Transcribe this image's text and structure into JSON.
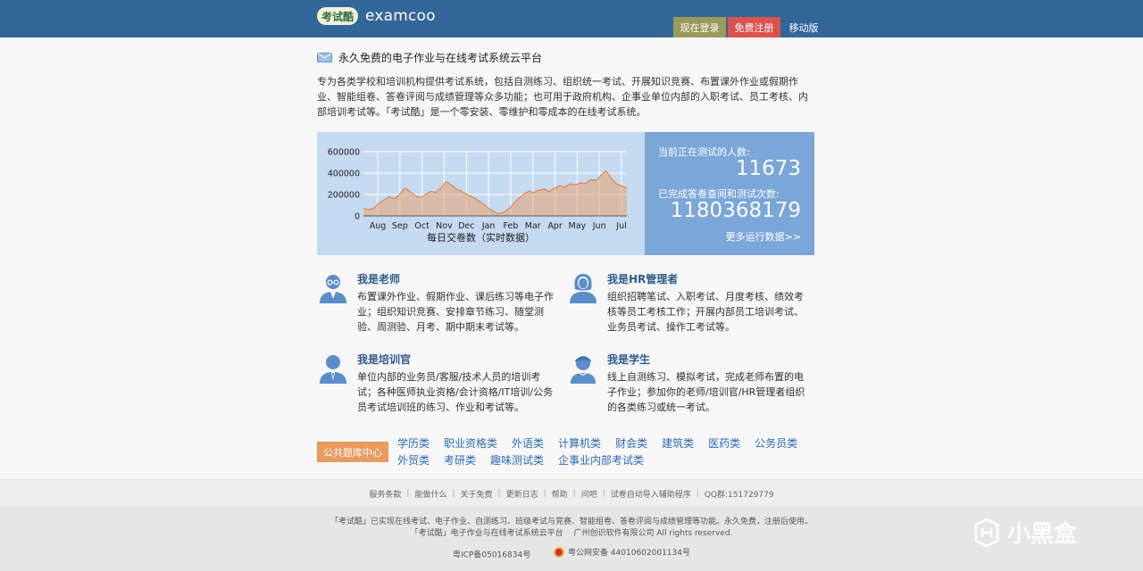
{
  "header": {
    "logo_badge": "考试酷",
    "logo_text": "examcoo",
    "login_label": "现在登录",
    "register_label": "免费注册",
    "mobile_label": "移动版"
  },
  "intro": {
    "title": "永久免费的电子作业与在线考试系统云平台",
    "desc": "专为各类学校和培训机构提供考试系统，包括自测练习、组织统一考试、开展知识竞赛、布置课外作业或假期作业、智能组卷、答卷评阅与成绩管理等众多功能；也可用于政府机构、企事业单位内部的入职考试、员工考核、内部培训考试等。「考试酷」是一个零安装、零维护和零成本的在线考试系统。"
  },
  "chart_data": {
    "type": "area",
    "title": "每日交卷数（实时数据）",
    "categories": [
      "Aug",
      "Sep",
      "Oct",
      "Nov",
      "Dec",
      "Jan",
      "Feb",
      "Mar",
      "Apr",
      "May",
      "Jun",
      "Jul"
    ],
    "y_ticks": [
      "600000",
      "400000",
      "200000",
      "0"
    ],
    "ylim": [
      0,
      600000
    ],
    "grid": true,
    "color": "#e8a070",
    "values": [
      70000,
      60000,
      70000,
      120000,
      150000,
      180000,
      160000,
      200000,
      260000,
      230000,
      190000,
      170000,
      200000,
      230000,
      220000,
      260000,
      320000,
      290000,
      250000,
      230000,
      200000,
      180000,
      150000,
      120000,
      80000,
      50000,
      20000,
      30000,
      60000,
      110000,
      160000,
      200000,
      230000,
      220000,
      240000,
      250000,
      230000,
      260000,
      280000,
      270000,
      300000,
      290000,
      310000,
      300000,
      340000,
      330000,
      380000,
      420000,
      350000,
      300000,
      280000,
      260000
    ]
  },
  "stats": {
    "testing_label": "当前正在测试的人数:",
    "testing_value": "11673",
    "completed_label": "已完成答卷查阅和测试次数:",
    "completed_value": "1180368179",
    "more_label": "更多运行数据>>"
  },
  "roles": [
    {
      "title": "我是老师",
      "desc": "布置课外作业、假期作业、课后练习等电子作业；组织知识竞赛、安排章节练习、随堂测验、周测验、月考、期中期末考试等。"
    },
    {
      "title": "我是HR管理者",
      "desc": "组织招聘笔试、入职考试、月度考核、绩效考核等员工考核工作；开展内部员工培训考试、业务员考试、操作工考试等。"
    },
    {
      "title": "我是培训官",
      "desc": "单位内部的业务员/客服/技术人员的培训考试；各种医师执业资格/会计资格/IT培训/公务员考试培训班的练习、作业和考试等。"
    },
    {
      "title": "我是学生",
      "desc": "线上自测练习、模拟考试，完成老师布置的电子作业；参加你的老师/培训官/HR管理者组织的各类练习或统一考试。"
    }
  ],
  "library": {
    "tag": "公共题库中心",
    "links": [
      "学历类",
      "职业资格类",
      "外语类",
      "计算机类",
      "财会类",
      "建筑类",
      "医药类",
      "公务员类",
      "外贸类",
      "考研类",
      "趣味测试类",
      "企事业内部考试类"
    ]
  },
  "footer": {
    "links": [
      "服务条款",
      "能做什么",
      "关于免费",
      "更新日志",
      "帮助",
      "问吧",
      "试卷自动导入辅助程序",
      "QQ群:151729779"
    ],
    "line1": "「考试酷」已实现在线考试、电子作业、自测练习、班级考试与竞赛、智能组卷、答卷评阅与成绩管理等功能。永久免费，注册后使用。",
    "line2": "「考试酷」电子作业与在线考试系统云平台　 广州创识软件有限公司  All rights reserved.",
    "icp": "粤ICP备05016834号",
    "police": "粤公网安备 44010602001134号"
  },
  "watermark": "小黑盒"
}
